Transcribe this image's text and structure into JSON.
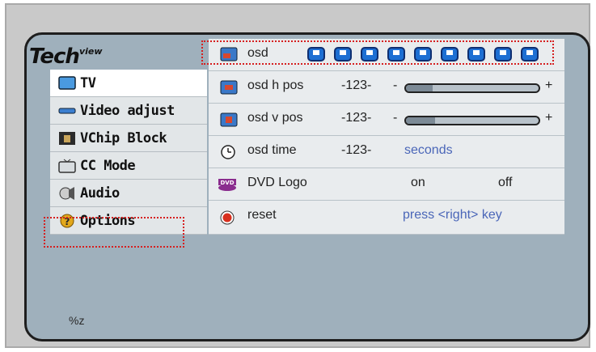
{
  "logo": {
    "text": "Tech",
    "sup": "view"
  },
  "menu": {
    "items": [
      {
        "label": "TV",
        "icon": "tv-icon"
      },
      {
        "label": "Video adjust",
        "icon": "video-adjust-icon"
      },
      {
        "label": "VChip Block",
        "icon": "vchip-icon"
      },
      {
        "label": "CC Mode",
        "icon": "cc-icon"
      },
      {
        "label": "Audio",
        "icon": "audio-icon"
      },
      {
        "label": "Options",
        "icon": "options-icon"
      }
    ]
  },
  "options_panel": {
    "osd_label": "osd",
    "osd_h_pos_label": "osd h pos",
    "osd_h_pos_value": "-123-",
    "osd_h_pos_slider_fraction": 0.2,
    "osd_v_pos_label": "osd v pos",
    "osd_v_pos_value": "-123-",
    "osd_v_pos_slider_fraction": 0.22,
    "osd_time_label": "osd time",
    "osd_time_value": "-123-",
    "osd_time_unit": "seconds",
    "dvd_logo_label": "DVD Logo",
    "dvd_on": "on",
    "dvd_off": "off",
    "reset_label": "reset",
    "reset_hint": "press <right> key",
    "slider_minus": "-",
    "slider_plus": "+"
  },
  "status": {
    "text": "%z"
  },
  "colors": {
    "highlight_dotted": "#d61f1f",
    "accent_blue": "#4a66b8",
    "osd_box_blue": "#1d6fd3",
    "screen_bg": "#9fb0bc",
    "row_bg": "#e9ecee"
  }
}
